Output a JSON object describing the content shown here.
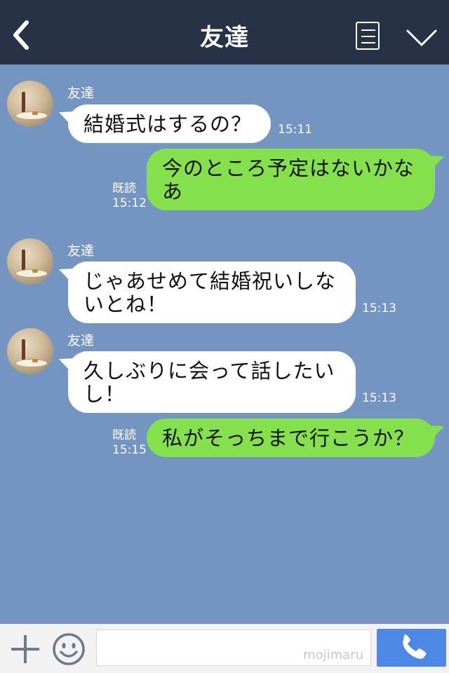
{
  "header": {
    "title": "友達"
  },
  "messages": [
    {
      "direction": "in",
      "sender": "友達",
      "text": "結婚式はするの？",
      "time": "15:11"
    },
    {
      "direction": "out",
      "text": "今のところ予定はないかなあ",
      "read_label": "既読",
      "time": "15:12"
    },
    {
      "direction": "in",
      "sender": "友達",
      "text": "じゃあせめて結婚祝いしないとね！",
      "time": "15:13"
    },
    {
      "direction": "in",
      "sender": "友達",
      "text": "久しぶりに会って話したいし！",
      "time": "15:13"
    },
    {
      "direction": "out",
      "text": "私がそっちまで行こうか？",
      "read_label": "既読",
      "time": "15:15"
    }
  ],
  "footer": {
    "watermark": "mojimaru"
  },
  "icons": {
    "back": "chevron-left-icon",
    "menu": "notes-icon",
    "dropdown": "chevron-down-icon",
    "add": "plus-icon",
    "emoji": "smiley-icon",
    "call": "phone-icon"
  },
  "colors": {
    "header_bg": "#273246",
    "chat_bg": "#7494c2",
    "incoming_bubble": "#ffffff",
    "outgoing_bubble": "#84e04b",
    "call_button": "#4e88e7"
  }
}
